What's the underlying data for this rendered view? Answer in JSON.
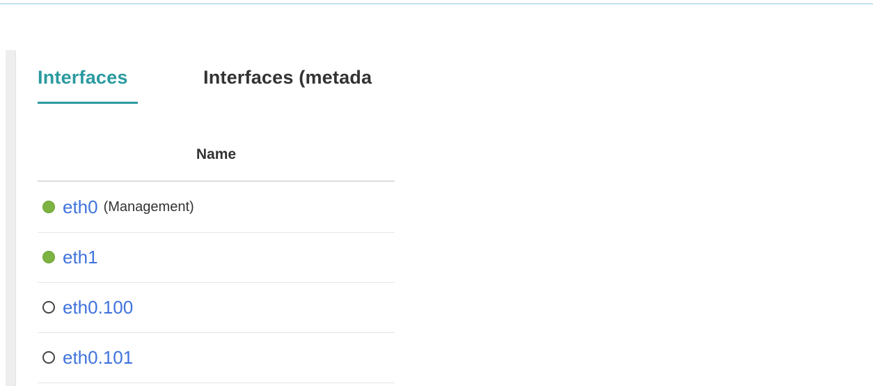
{
  "tabs": [
    {
      "label": "Interfaces",
      "active": true
    },
    {
      "label": "Interfaces (metada",
      "active": false
    }
  ],
  "table": {
    "header": "Name",
    "rows": [
      {
        "name": "eth0",
        "note": "(Management)",
        "status": "up"
      },
      {
        "name": "eth1",
        "note": "",
        "status": "up"
      },
      {
        "name": "eth0.100",
        "note": "",
        "status": "down"
      },
      {
        "name": "eth0.101",
        "note": "",
        "status": "down"
      }
    ]
  },
  "colors": {
    "accent": "#2c9aa0",
    "link": "#3f73dd",
    "status_up": "#7cb342"
  }
}
